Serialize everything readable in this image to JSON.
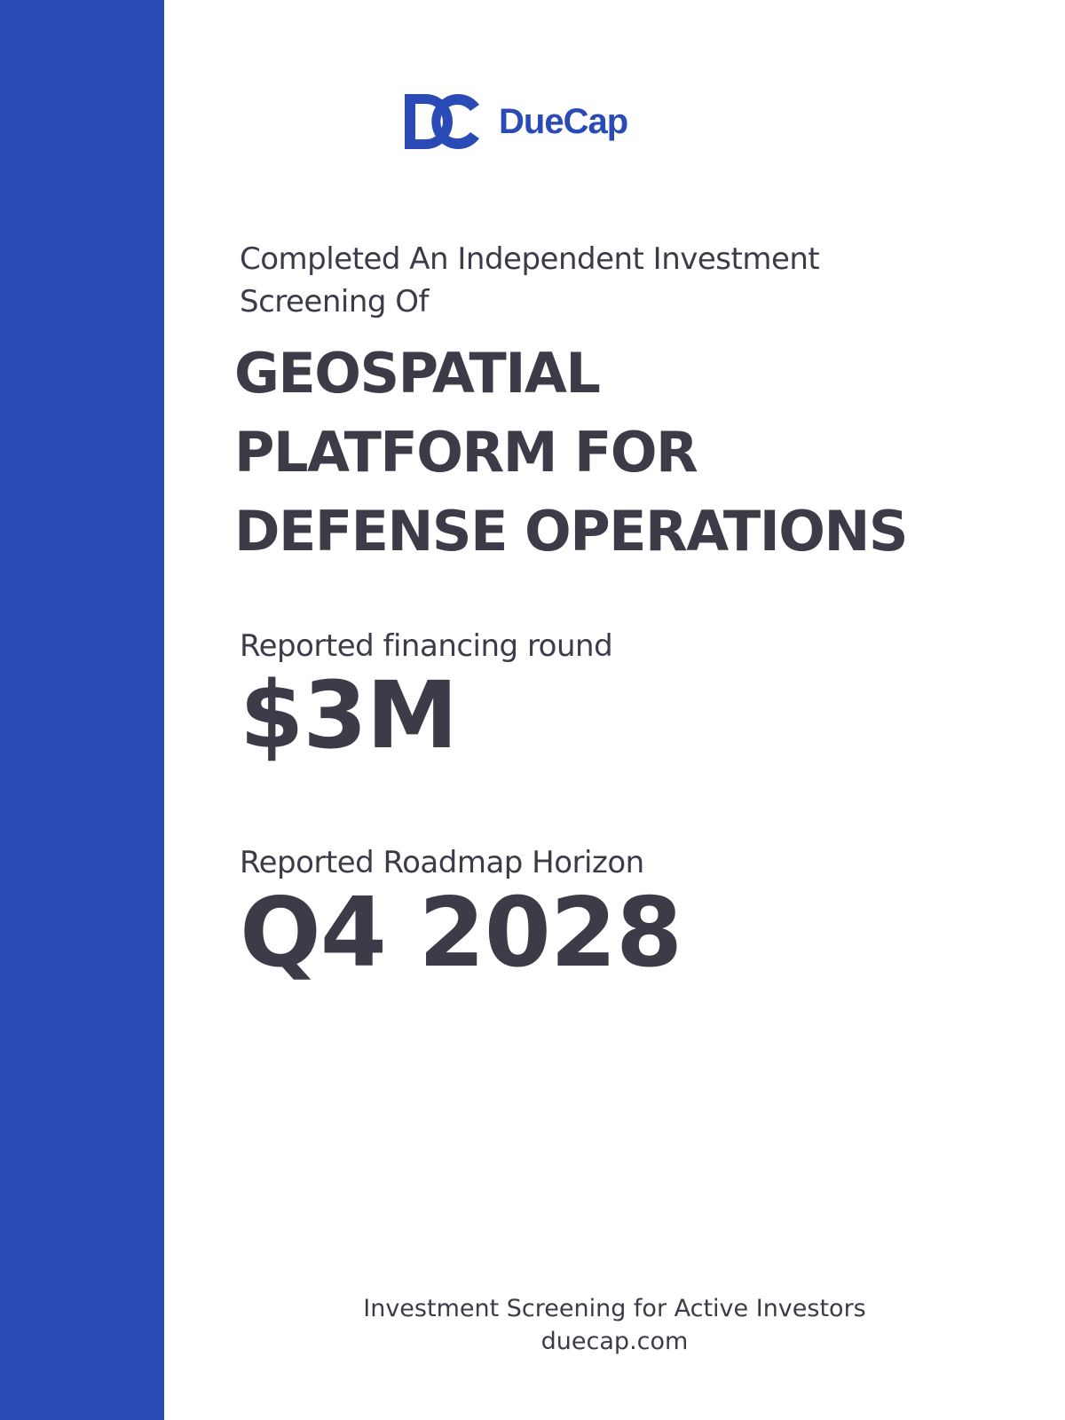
{
  "brand": {
    "name": "DueCap",
    "logo_icon": "dc-monogram-icon",
    "color": "#2a4bb5"
  },
  "colors": {
    "sidebar": "#2a4bb5",
    "text": "#3c3c48",
    "background": "#ffffff"
  },
  "intro": {
    "line1": "Completed An Independent Investment",
    "line2": "Screening Of"
  },
  "headline": {
    "line1": "GEOSPATIAL",
    "line2": "PLATFORM FOR",
    "line3": "DEFENSE OPERATIONS"
  },
  "financing": {
    "label": "Reported financing round",
    "value": "$3M"
  },
  "roadmap": {
    "label": "Reported Roadmap Horizon",
    "value": "Q4 2028"
  },
  "footer": {
    "tagline": "Investment Screening for Active Investors",
    "website": "duecap.com"
  }
}
